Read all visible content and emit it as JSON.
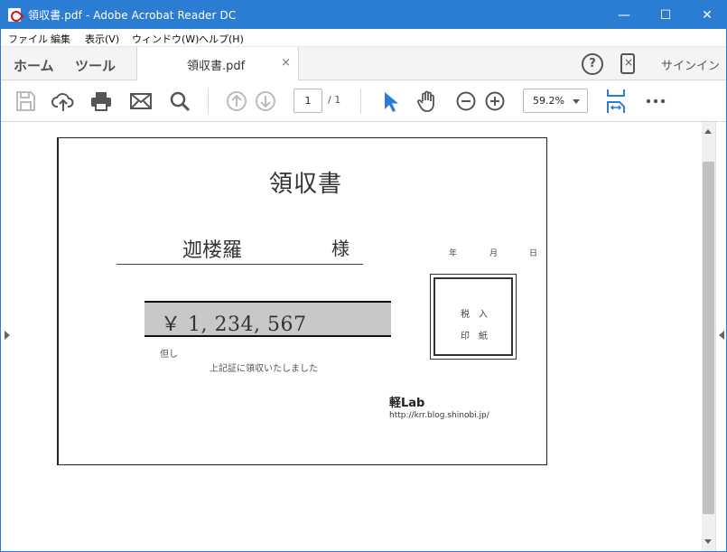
{
  "titlebar": {
    "title": "領収書.pdf - Adobe Acrobat Reader DC",
    "minimize": "—",
    "maximize": "☐",
    "close": "✕"
  },
  "menu": {
    "items": [
      "ファイル",
      "編集",
      "表示(V)",
      "ウィンドウ(W)",
      "ヘルプ(H)"
    ]
  },
  "tabs": {
    "home": "ホーム",
    "tools": "ツール",
    "document": "領収書.pdf",
    "close": "×",
    "help": "?",
    "signin": "サインイン"
  },
  "toolbar": {
    "page_current": "1",
    "page_total": "/ 1",
    "zoom": "59.2%"
  },
  "document": {
    "title": "領収書",
    "payee": "迦楼羅",
    "honorific": "様",
    "date_year": "年",
    "date_month": "月",
    "date_day": "日",
    "amount": "￥ 1, 234, 567",
    "tadashi": "但し",
    "note": "上記証に領収いたしました",
    "stamp_line1": "税入",
    "stamp_line2": "印紙",
    "brand": "軽Lab",
    "url": "http://krr.blog.shinobi.jp/"
  },
  "colors": {
    "titlebar": "#2b7cd3",
    "accent_blue": "#2b7cd3"
  }
}
